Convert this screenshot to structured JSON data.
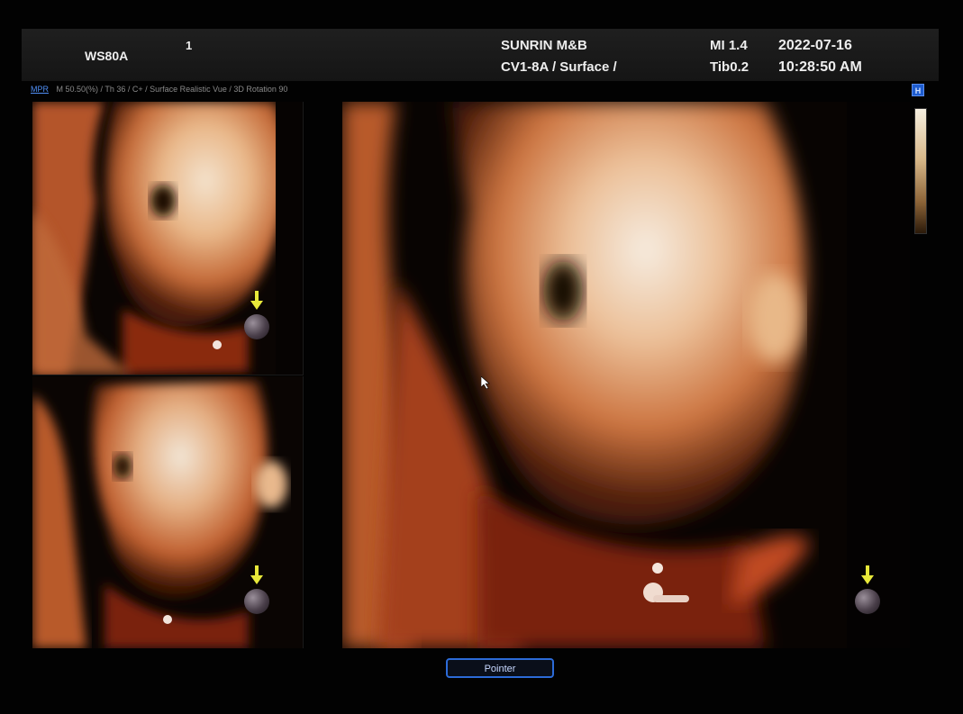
{
  "header": {
    "model": "WS80A",
    "number": "1",
    "site": "SUNRIN M&B",
    "probe": "CV1-8A / Surface /",
    "mi": "MI  1.4",
    "tib": "Tib0.2",
    "date": "2022-07-16",
    "time": "10:28:50 AM"
  },
  "status": {
    "mode_link": "MPR",
    "params": "M 50.50(%) / Th 36 / C+ / Surface Realistic Vue / 3D Rotation 90",
    "badge": "H"
  },
  "viewports": [
    {
      "name": "rendering-view-top-left",
      "label": ""
    },
    {
      "name": "rendering-view-bottom-left",
      "label": ""
    },
    {
      "name": "rendering-view-main",
      "label": ""
    }
  ],
  "icons": {
    "light": "light-source-sphere-icon",
    "arrow": "arrow-down-icon",
    "cursor": "mouse-cursor-icon"
  },
  "colors": {
    "arrow": "#e8e83a",
    "button_border": "#2c6bd8",
    "mode_link": "#4f8ef5"
  },
  "footer": {
    "pointer_label": "Pointer"
  }
}
